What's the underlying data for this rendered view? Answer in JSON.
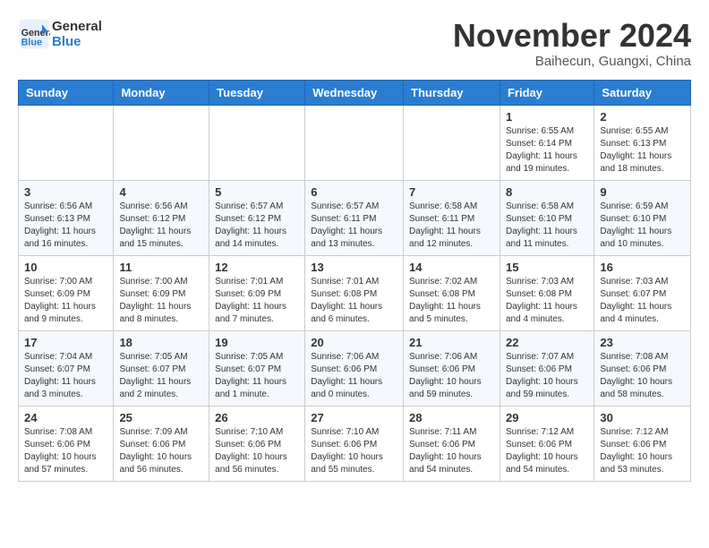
{
  "header": {
    "logo_line1": "General",
    "logo_line2": "Blue",
    "month_title": "November 2024",
    "location": "Baihecun, Guangxi, China"
  },
  "days_of_week": [
    "Sunday",
    "Monday",
    "Tuesday",
    "Wednesday",
    "Thursday",
    "Friday",
    "Saturday"
  ],
  "weeks": [
    [
      {
        "day": "",
        "content": ""
      },
      {
        "day": "",
        "content": ""
      },
      {
        "day": "",
        "content": ""
      },
      {
        "day": "",
        "content": ""
      },
      {
        "day": "",
        "content": ""
      },
      {
        "day": "1",
        "content": "Sunrise: 6:55 AM\nSunset: 6:14 PM\nDaylight: 11 hours and 19 minutes."
      },
      {
        "day": "2",
        "content": "Sunrise: 6:55 AM\nSunset: 6:13 PM\nDaylight: 11 hours and 18 minutes."
      }
    ],
    [
      {
        "day": "3",
        "content": "Sunrise: 6:56 AM\nSunset: 6:13 PM\nDaylight: 11 hours and 16 minutes."
      },
      {
        "day": "4",
        "content": "Sunrise: 6:56 AM\nSunset: 6:12 PM\nDaylight: 11 hours and 15 minutes."
      },
      {
        "day": "5",
        "content": "Sunrise: 6:57 AM\nSunset: 6:12 PM\nDaylight: 11 hours and 14 minutes."
      },
      {
        "day": "6",
        "content": "Sunrise: 6:57 AM\nSunset: 6:11 PM\nDaylight: 11 hours and 13 minutes."
      },
      {
        "day": "7",
        "content": "Sunrise: 6:58 AM\nSunset: 6:11 PM\nDaylight: 11 hours and 12 minutes."
      },
      {
        "day": "8",
        "content": "Sunrise: 6:58 AM\nSunset: 6:10 PM\nDaylight: 11 hours and 11 minutes."
      },
      {
        "day": "9",
        "content": "Sunrise: 6:59 AM\nSunset: 6:10 PM\nDaylight: 11 hours and 10 minutes."
      }
    ],
    [
      {
        "day": "10",
        "content": "Sunrise: 7:00 AM\nSunset: 6:09 PM\nDaylight: 11 hours and 9 minutes."
      },
      {
        "day": "11",
        "content": "Sunrise: 7:00 AM\nSunset: 6:09 PM\nDaylight: 11 hours and 8 minutes."
      },
      {
        "day": "12",
        "content": "Sunrise: 7:01 AM\nSunset: 6:09 PM\nDaylight: 11 hours and 7 minutes."
      },
      {
        "day": "13",
        "content": "Sunrise: 7:01 AM\nSunset: 6:08 PM\nDaylight: 11 hours and 6 minutes."
      },
      {
        "day": "14",
        "content": "Sunrise: 7:02 AM\nSunset: 6:08 PM\nDaylight: 11 hours and 5 minutes."
      },
      {
        "day": "15",
        "content": "Sunrise: 7:03 AM\nSunset: 6:08 PM\nDaylight: 11 hours and 4 minutes."
      },
      {
        "day": "16",
        "content": "Sunrise: 7:03 AM\nSunset: 6:07 PM\nDaylight: 11 hours and 4 minutes."
      }
    ],
    [
      {
        "day": "17",
        "content": "Sunrise: 7:04 AM\nSunset: 6:07 PM\nDaylight: 11 hours and 3 minutes."
      },
      {
        "day": "18",
        "content": "Sunrise: 7:05 AM\nSunset: 6:07 PM\nDaylight: 11 hours and 2 minutes."
      },
      {
        "day": "19",
        "content": "Sunrise: 7:05 AM\nSunset: 6:07 PM\nDaylight: 11 hours and 1 minute."
      },
      {
        "day": "20",
        "content": "Sunrise: 7:06 AM\nSunset: 6:06 PM\nDaylight: 11 hours and 0 minutes."
      },
      {
        "day": "21",
        "content": "Sunrise: 7:06 AM\nSunset: 6:06 PM\nDaylight: 10 hours and 59 minutes."
      },
      {
        "day": "22",
        "content": "Sunrise: 7:07 AM\nSunset: 6:06 PM\nDaylight: 10 hours and 59 minutes."
      },
      {
        "day": "23",
        "content": "Sunrise: 7:08 AM\nSunset: 6:06 PM\nDaylight: 10 hours and 58 minutes."
      }
    ],
    [
      {
        "day": "24",
        "content": "Sunrise: 7:08 AM\nSunset: 6:06 PM\nDaylight: 10 hours and 57 minutes."
      },
      {
        "day": "25",
        "content": "Sunrise: 7:09 AM\nSunset: 6:06 PM\nDaylight: 10 hours and 56 minutes."
      },
      {
        "day": "26",
        "content": "Sunrise: 7:10 AM\nSunset: 6:06 PM\nDaylight: 10 hours and 56 minutes."
      },
      {
        "day": "27",
        "content": "Sunrise: 7:10 AM\nSunset: 6:06 PM\nDaylight: 10 hours and 55 minutes."
      },
      {
        "day": "28",
        "content": "Sunrise: 7:11 AM\nSunset: 6:06 PM\nDaylight: 10 hours and 54 minutes."
      },
      {
        "day": "29",
        "content": "Sunrise: 7:12 AM\nSunset: 6:06 PM\nDaylight: 10 hours and 54 minutes."
      },
      {
        "day": "30",
        "content": "Sunrise: 7:12 AM\nSunset: 6:06 PM\nDaylight: 10 hours and 53 minutes."
      }
    ]
  ]
}
